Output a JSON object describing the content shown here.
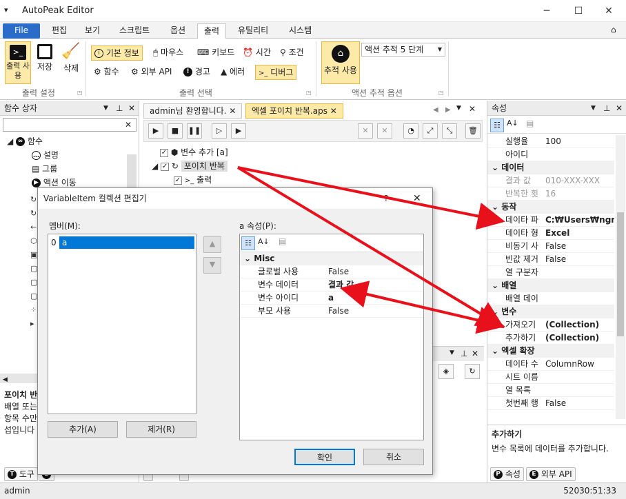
{
  "window": {
    "title": "AutoPeak Editor",
    "menu_icon": "▾",
    "min": "─",
    "max": "☐",
    "close": "✕"
  },
  "ribbon": {
    "tabs": [
      "File",
      "편집",
      "보기",
      "스크립트",
      "옵션",
      "출력",
      "유틸리티",
      "시스템"
    ],
    "collapse": "⌂",
    "output_settings": {
      "label": "출력 설정",
      "use": "출력 사용",
      "save": "저장",
      "delete": "삭제"
    },
    "output_select": {
      "label": "출력 선택",
      "basic_info": "기본 정보",
      "mouse": "마우스",
      "keyboard": "키보드",
      "time": "시간",
      "condition": "조건",
      "function": "함수",
      "external_api": "외부 API",
      "warning": "경고",
      "error": "에러",
      "debug": "디버그"
    },
    "trace": {
      "label": "액션 추적 옵션",
      "use": "추적 사용",
      "level": "액션 추적 5 단계"
    }
  },
  "function_box": {
    "title": "함수 상자",
    "root": "함수",
    "items": [
      "설명",
      "그룹",
      "액션 이동"
    ],
    "desc_title": "포이치 반복",
    "desc_lines": [
      "배열 또는",
      "항목 수만",
      "섭입니다"
    ],
    "tab_tools": "도구",
    "tab_other": "B"
  },
  "doc_tabs": {
    "welcome": "admin님 환영합니다.",
    "current": "엑셀 포이치 반복.aps"
  },
  "tree": {
    "var_add": "변수 추가 [a]",
    "foreach": "포이치 반복",
    "output": "출력"
  },
  "properties": {
    "title": "속성",
    "rows": [
      {
        "name": "실행율",
        "value": "100",
        "cat": false
      },
      {
        "name": "아이디",
        "value": "",
        "cat": false
      },
      {
        "name": "데이터",
        "value": "",
        "cat": true
      },
      {
        "name": "결과 값",
        "value": "010-XXX-XXX",
        "cat": false,
        "gray": true
      },
      {
        "name": "반복한 횟",
        "value": "16",
        "cat": false,
        "gray": true
      },
      {
        "name": "동작",
        "value": "",
        "cat": true
      },
      {
        "name": "데이타 파",
        "value": "C:₩Users₩ngma",
        "cat": false,
        "bold": true
      },
      {
        "name": "데이타 형",
        "value": "Excel",
        "cat": false,
        "bold": true
      },
      {
        "name": "비동기 사",
        "value": "False",
        "cat": false
      },
      {
        "name": "빈값 제거",
        "value": "False",
        "cat": false
      },
      {
        "name": "열 구분자",
        "value": "",
        "cat": false
      },
      {
        "name": "배열",
        "value": "",
        "cat": true
      },
      {
        "name": "배열 데이",
        "value": "",
        "cat": false
      },
      {
        "name": "변수",
        "value": "",
        "cat": true
      },
      {
        "name": "가져오기",
        "value": "(Collection)",
        "cat": false,
        "bold": true
      },
      {
        "name": "추가하기",
        "value": "(Collection)",
        "cat": false,
        "bold": true
      },
      {
        "name": "엑셀 확장",
        "value": "",
        "cat": true
      },
      {
        "name": "데이타 수",
        "value": "ColumnRow",
        "cat": false
      },
      {
        "name": "시트 이름",
        "value": "",
        "cat": false
      },
      {
        "name": "열 목록",
        "value": "",
        "cat": false
      },
      {
        "name": "첫번째 행",
        "value": "False",
        "cat": false
      }
    ],
    "desc_title": "추가하기",
    "desc_text": "변수 목록에 데이터를 추가합니다.",
    "tab_props": "속성",
    "tab_api": "외부 API"
  },
  "dialog": {
    "title": "VariableItem 컬렉션 편집기",
    "help": "?",
    "members_label": "멤버(M):",
    "member_index": "0",
    "member_name": "a",
    "props_label": "a 속성(P):",
    "category": "Misc",
    "rows": [
      {
        "name": "글로벌 사용",
        "value": "False",
        "bold": false
      },
      {
        "name": "변수 데이터",
        "value": "결과 값",
        "bold": true
      },
      {
        "name": "변수 아이디",
        "value": "a",
        "bold": true
      },
      {
        "name": "부모 사용",
        "value": "False",
        "bold": false
      }
    ],
    "add": "추가(A)",
    "remove": "제거(R)",
    "ok": "확인",
    "cancel": "취소"
  },
  "status": {
    "left": "admin",
    "right": "52030:51:33"
  },
  "colors": {
    "accent": "#2a6cc7",
    "highlight": "#fde9a8",
    "arrow": "#e8111b"
  }
}
